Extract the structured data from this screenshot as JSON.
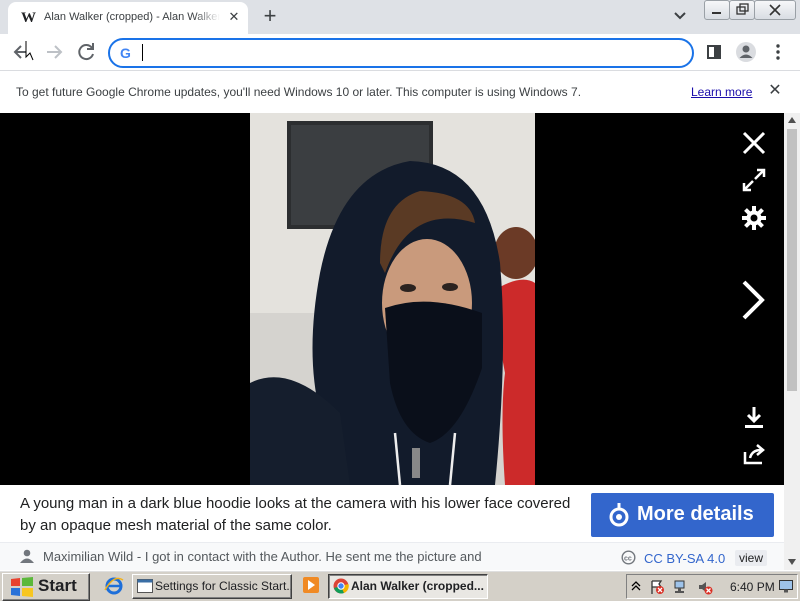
{
  "browser": {
    "tab_title": "Alan Walker (cropped) - Alan Walker",
    "tab_favicon": "W",
    "omnibox_value": "",
    "omnibox_icon": "google-g-icon"
  },
  "infobar": {
    "message": "To get future Google Chrome updates, you'll need Windows 10 or later. This computer is using Windows 7.",
    "link": "Learn more"
  },
  "viewer": {
    "caption": "A young man in a dark blue hoodie looks at the camera with his lower face covered by an opaque mesh material of the same color.",
    "more_details": "More details",
    "author": "Maximilian Wild - I got in contact with the Author. He sent me the picture and",
    "license": "CC BY-SA 4.0",
    "view": "view"
  },
  "taskbar": {
    "start": "Start",
    "tasks": [
      {
        "label": "Settings for Classic Start..."
      },
      {
        "label": "Alan Walker (cropped..."
      }
    ],
    "clock": "6:40 PM"
  },
  "colors": {
    "accent": "#1a73e8",
    "more_button": "#3366cc",
    "taskbar": "#d4d0c8"
  }
}
